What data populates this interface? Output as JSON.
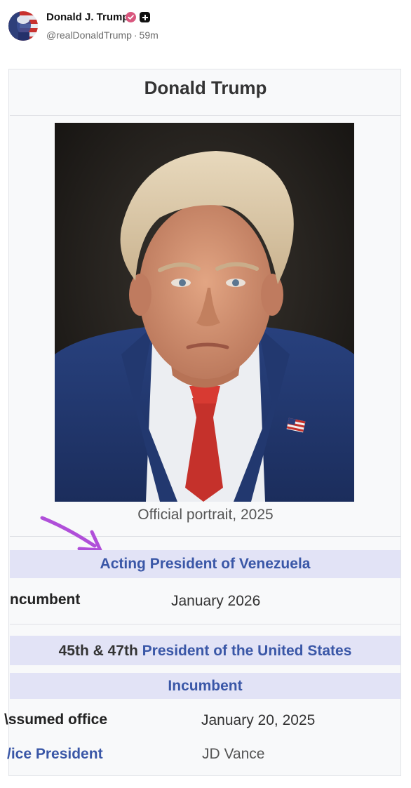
{
  "post": {
    "author_name": "Donald J. Trump",
    "handle": "@realDonaldTrump",
    "separator": "·",
    "time_ago": "59m",
    "icons": {
      "verified": "verified-badge-icon",
      "follow": "follow-plus-icon"
    },
    "colors": {
      "verified": "#d9577e",
      "text": "#111111",
      "muted": "#6b6b6b"
    }
  },
  "infobox": {
    "title": "Donald Trump",
    "portrait_caption": "Official portrait, 2025",
    "section_venezuela": {
      "heading": "Acting President of Venezuela",
      "incumbent_label": "ncumbent",
      "incumbent_value": "January 2026"
    },
    "section_us": {
      "heading_prefix": "45th & 47th",
      "heading_link": "President of the United States",
      "status": "Incumbent",
      "assumed_label": "\\ssumed office",
      "assumed_value": "January 20, 2025",
      "vp_label": "/ice President",
      "vp_value": "JD Vance"
    },
    "colors": {
      "band": "#e2e3f6",
      "link": "#3a57a7",
      "background": "#f8f9fa",
      "arrow": "#b04fd9"
    }
  }
}
